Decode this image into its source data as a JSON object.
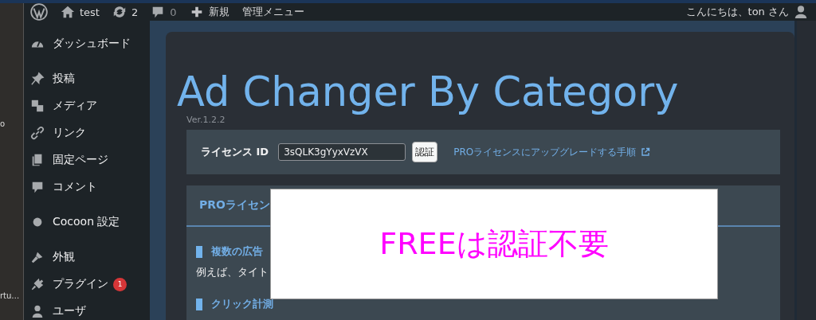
{
  "left_strip": {
    "texts": [
      "o",
      "rtu…"
    ]
  },
  "admin_bar": {
    "items": [
      {
        "kind": "logo"
      },
      {
        "kind": "home",
        "label": "test"
      },
      {
        "kind": "updates",
        "label": "2"
      },
      {
        "kind": "comments",
        "label": "0"
      },
      {
        "kind": "new",
        "label": "新規"
      },
      {
        "kind": "text",
        "label": "管理メニュー"
      }
    ],
    "greeting": "こんにちは、ton さん"
  },
  "sidebar": {
    "groups": [
      {
        "items": [
          {
            "kind": "dashboard",
            "label": "ダッシュボード"
          }
        ]
      },
      {
        "items": [
          {
            "kind": "pin",
            "label": "投稿"
          },
          {
            "kind": "media",
            "label": "メディア"
          },
          {
            "kind": "link",
            "label": "リンク"
          },
          {
            "kind": "pages",
            "label": "固定ページ"
          },
          {
            "kind": "comment",
            "label": "コメント"
          }
        ]
      },
      {
        "items": [
          {
            "kind": "dot",
            "label": "Cocoon 設定"
          }
        ]
      },
      {
        "items": [
          {
            "kind": "brush",
            "label": "外観"
          },
          {
            "kind": "plugin",
            "label": "プラグイン",
            "badge": "1"
          },
          {
            "kind": "user",
            "label": "ユーザ"
          }
        ]
      }
    ]
  },
  "page": {
    "title": "Ad Changer By Category",
    "version": "Ver.1.2.2",
    "license": {
      "label": "ライセンス ID",
      "value": "3sQLK3gYyxVzVX",
      "button": "認証",
      "link": "PROライセンスにアップグレードする手順"
    },
    "pro_section": {
      "heading": "PROライセン",
      "items": [
        {
          "heading": "複数の広告",
          "text": "例えば、タイト"
        },
        {
          "heading": "クリック計測"
        }
      ]
    }
  },
  "overlay": {
    "text": "FREEは認証不要"
  }
}
